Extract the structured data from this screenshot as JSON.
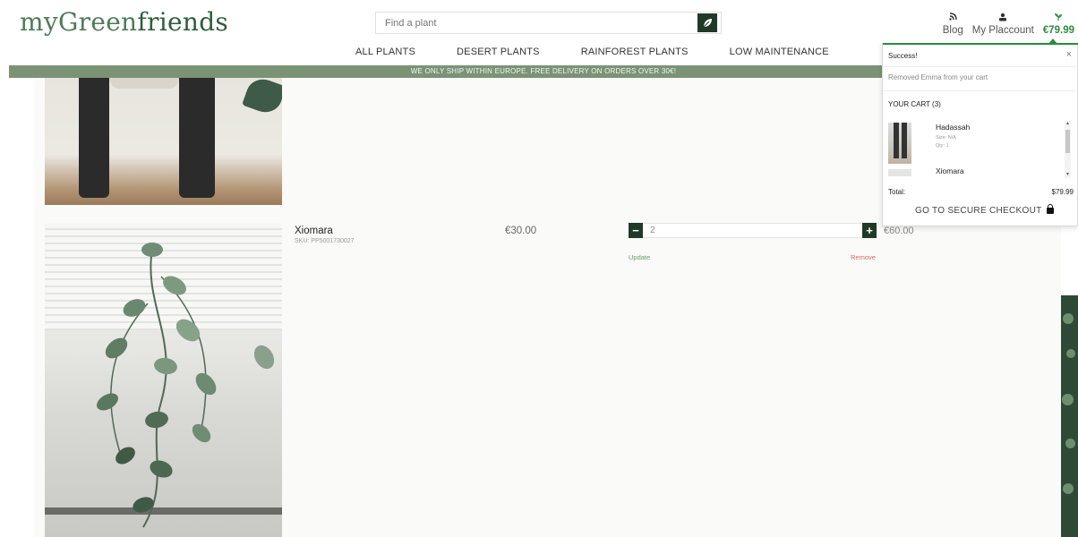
{
  "header": {
    "logo_prefix": "myGreen",
    "logo_suffix": "friends",
    "search": {
      "placeholder": "Find a plant",
      "button_icon": "leaf-icon"
    },
    "user_nav": [
      {
        "label": "Blog",
        "icon": "blog-icon"
      },
      {
        "label": "My Placcount",
        "icon": "account-icon"
      },
      {
        "label": "€79.99",
        "icon": "cart-plant-icon"
      }
    ]
  },
  "main_nav": [
    "ALL PLANTS",
    "DESERT PLANTS",
    "RAINFOREST PLANTS",
    "LOW MAINTENANCE"
  ],
  "banner": "WE ONLY SHIP WITHIN EUROPE. FREE DELIVERY ON ORDERS OVER 30€!",
  "cart_row": {
    "name": "Xiomara",
    "sku": "SKU: PP5001730027",
    "price": "€30.00",
    "quantity": "2",
    "update": "Update",
    "remove": "Remove",
    "line_total": "€60.00"
  },
  "cart_popup": {
    "success": "Success!",
    "close": "×",
    "message": "Removed Emma from your cart",
    "heading": "YOUR CART (3)",
    "items": [
      {
        "name": "Hadassah",
        "size": "Size: N/A",
        "qty": "Qty: 1"
      },
      {
        "name": "Xiomara"
      }
    ],
    "total_label": "Total:",
    "total_value": "$79.99",
    "checkout": "GO TO SECURE CHECKOUT"
  },
  "colors": {
    "brand_green": "#4f7a57",
    "dark_green": "#1f3a29",
    "banner_green": "#7a9375",
    "accent_green": "#2e8b3e",
    "remove_red": "#d96a6a"
  }
}
